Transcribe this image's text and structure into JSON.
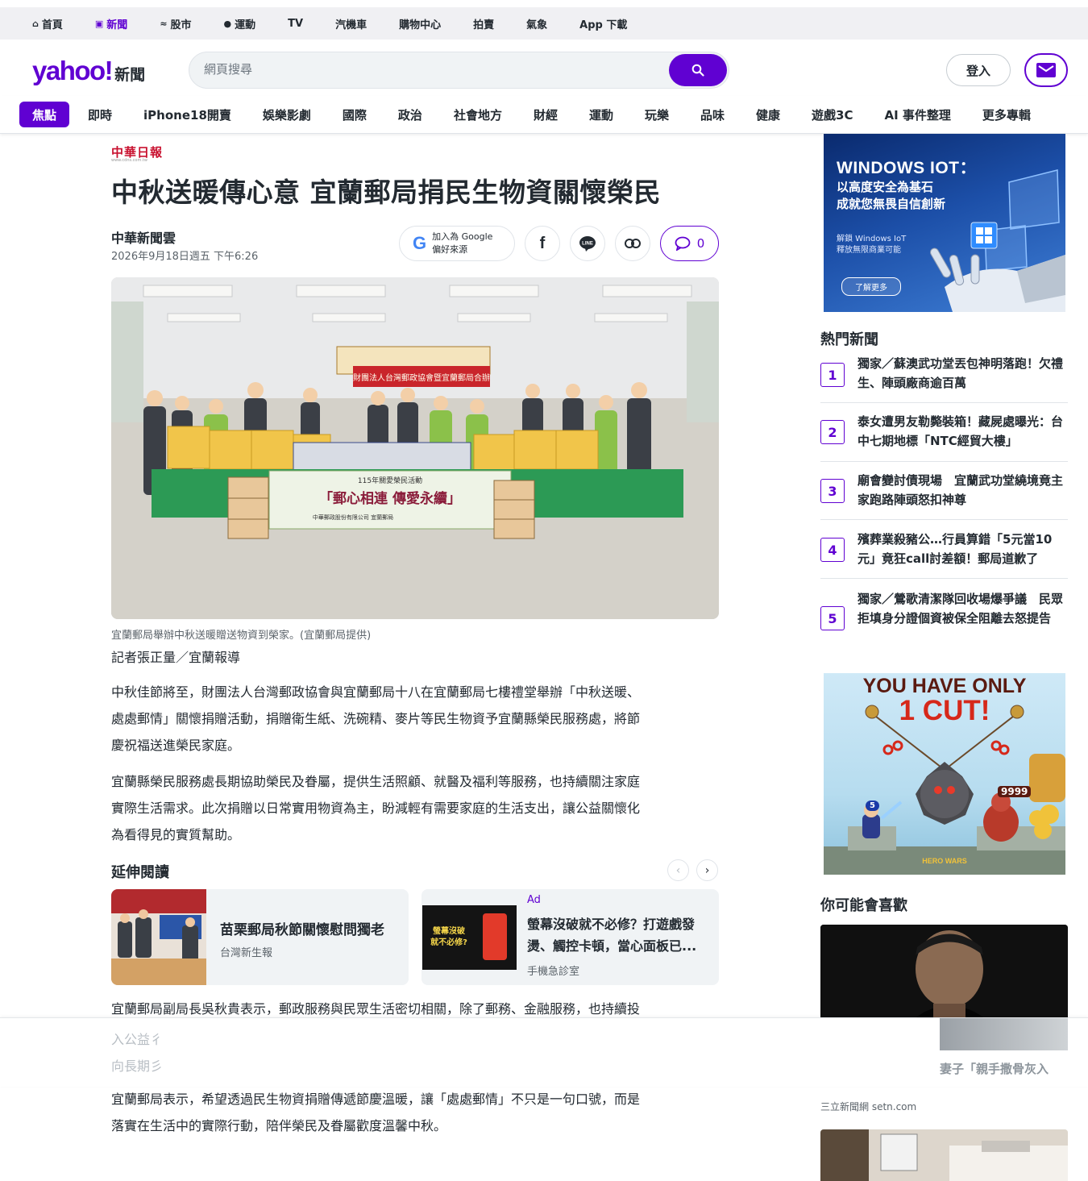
{
  "topbar": {
    "items": [
      {
        "label": "首頁",
        "icon": "home-icon"
      },
      {
        "label": "新聞",
        "icon": "news-icon",
        "active": true
      },
      {
        "label": "股市",
        "icon": "chart-icon"
      },
      {
        "label": "運動",
        "icon": "ball-icon"
      },
      {
        "label": "TV"
      },
      {
        "label": "汽機車"
      },
      {
        "label": "購物中心"
      },
      {
        "label": "拍賣"
      },
      {
        "label": "氣象"
      },
      {
        "label": "App 下載"
      }
    ]
  },
  "header": {
    "logo": "yahoo!",
    "logo_suffix": "新聞",
    "search_placeholder": "網頁搜尋",
    "login": "登入",
    "brand_color": "#6001d2"
  },
  "nav": {
    "items": [
      "焦點",
      "即時",
      "iPhone18開賣",
      "娛樂影劇",
      "國際",
      "政治",
      "社會地方",
      "財經",
      "運動",
      "玩樂",
      "品味",
      "健康",
      "遊戲3C",
      "AI 事件整理",
      "更多專輯"
    ]
  },
  "article": {
    "publisher_logo": "中華日報",
    "publisher_url": "www.cdns.com.tw",
    "headline": "中秋送暖傳心意 宜蘭郵局捐民生物資關懷榮民",
    "author": "中華新聞雲",
    "date": "2026年9月18日週五 下午6:26",
    "google_follow": [
      "加入為 Google",
      "偏好來源"
    ],
    "comments": "0",
    "hero": {
      "banner": "財團法人台灣郵政協會暨宜蘭郵局合辦",
      "event": "115年關愛榮民活動",
      "slogan": "「郵心相連 傳愛永續」",
      "org": "中華郵政股份有限公司 宜蘭郵局"
    },
    "caption": "宜蘭郵局舉辦中秋送暖贈送物資到榮家。(宜蘭郵局提供)",
    "reporter": "記者張正量／宜蘭報導",
    "paragraphs": [
      [
        "中秋佳節將至，財團法人台灣郵政協會與宜蘭郵局十八在宜蘭郵局七樓禮堂舉辦「中秋送暖、",
        "處處郵情」關懷捐贈活動，捐贈衛生紙、洗碗精、麥片等民生物資予宜蘭縣榮民服務處，將節",
        "慶祝福送進榮民家庭。"
      ],
      [
        "宜蘭縣榮民服務處長期協助榮民及眷屬，提供生活照顧、就醫及福利等服務，也持續關注家庭",
        "實際生活需求。此次捐贈以日常實用物資為主，盼減輕有需要家庭的生活支出，讓公益關懷化",
        "為看得見的實質幫助。"
      ],
      [
        "宜蘭郵局副局長吳秋貴表示，郵政服務與民眾生活密切相關，除了郵務、金融服務，也持續投"
      ],
      [
        "宜蘭郵局表示，希望透過民生物資捐贈傳遞節慶溫暖，讓「處處郵情」不只是一句口號，而是",
        "落實在生活中的實際行動，陪伴榮民及眷屬歡度溫馨中秋。"
      ]
    ],
    "obscured_lines": [
      "入公益彳",
      "向長期彡"
    ]
  },
  "extended": {
    "title": "延伸閱讀",
    "cards": [
      {
        "title": "苗栗郵局秋節關懷慰問獨老",
        "source": "台灣新生報"
      },
      {
        "ad": "Ad",
        "title": "螢幕沒破就不必修？打遊戲發燙、觸控卡頓，當心面板已...",
        "source": "手機急診室",
        "thumb_text": "螢幕沒破\n就不必修?"
      }
    ]
  },
  "sidebar": {
    "ad1": {
      "title": "WINDOWS IOT：",
      "subtitle": "以高度安全為基石\n成就您無畏自信創新",
      "small": "解鎖 Windows IoT\n釋放無限商業可能",
      "cta": "了解更多"
    },
    "hot_title": "熱門新聞",
    "hot": [
      {
        "num": "1",
        "title": "獨家／蘇澳武功堂丟包神明落跑！欠禮生、陣頭廠商逾百萬"
      },
      {
        "num": "2",
        "title": "泰女遭男友勒斃裝箱！藏屍處曝光：台中七期地標「NTC經貿大樓」"
      },
      {
        "num": "3",
        "title": "廟會變討債現場　宜蘭武功堂繞境竟主家跑路陣頭怒扣神尊"
      },
      {
        "num": "4",
        "title": "殯葬業殺豬公…行員算錯「5元當10元」竟狂call討差額！郵局道歉了"
      },
      {
        "num": "5",
        "title": "獨家／鶯歌清潔隊回收場爆爭議　民眾拒填身分證個資被保全阻離去怒提告"
      }
    ],
    "ad2": {
      "line1": "YOU HAVE ONLY",
      "line2": "1 CUT!",
      "hero_num": "5",
      "gold_num": "9999",
      "brand": "HERO WARS"
    },
    "like_title": "你可能會喜歡",
    "like_partial": "妻子「親手撒骨灰入",
    "like_source": "三立新聞網 setn.com"
  }
}
